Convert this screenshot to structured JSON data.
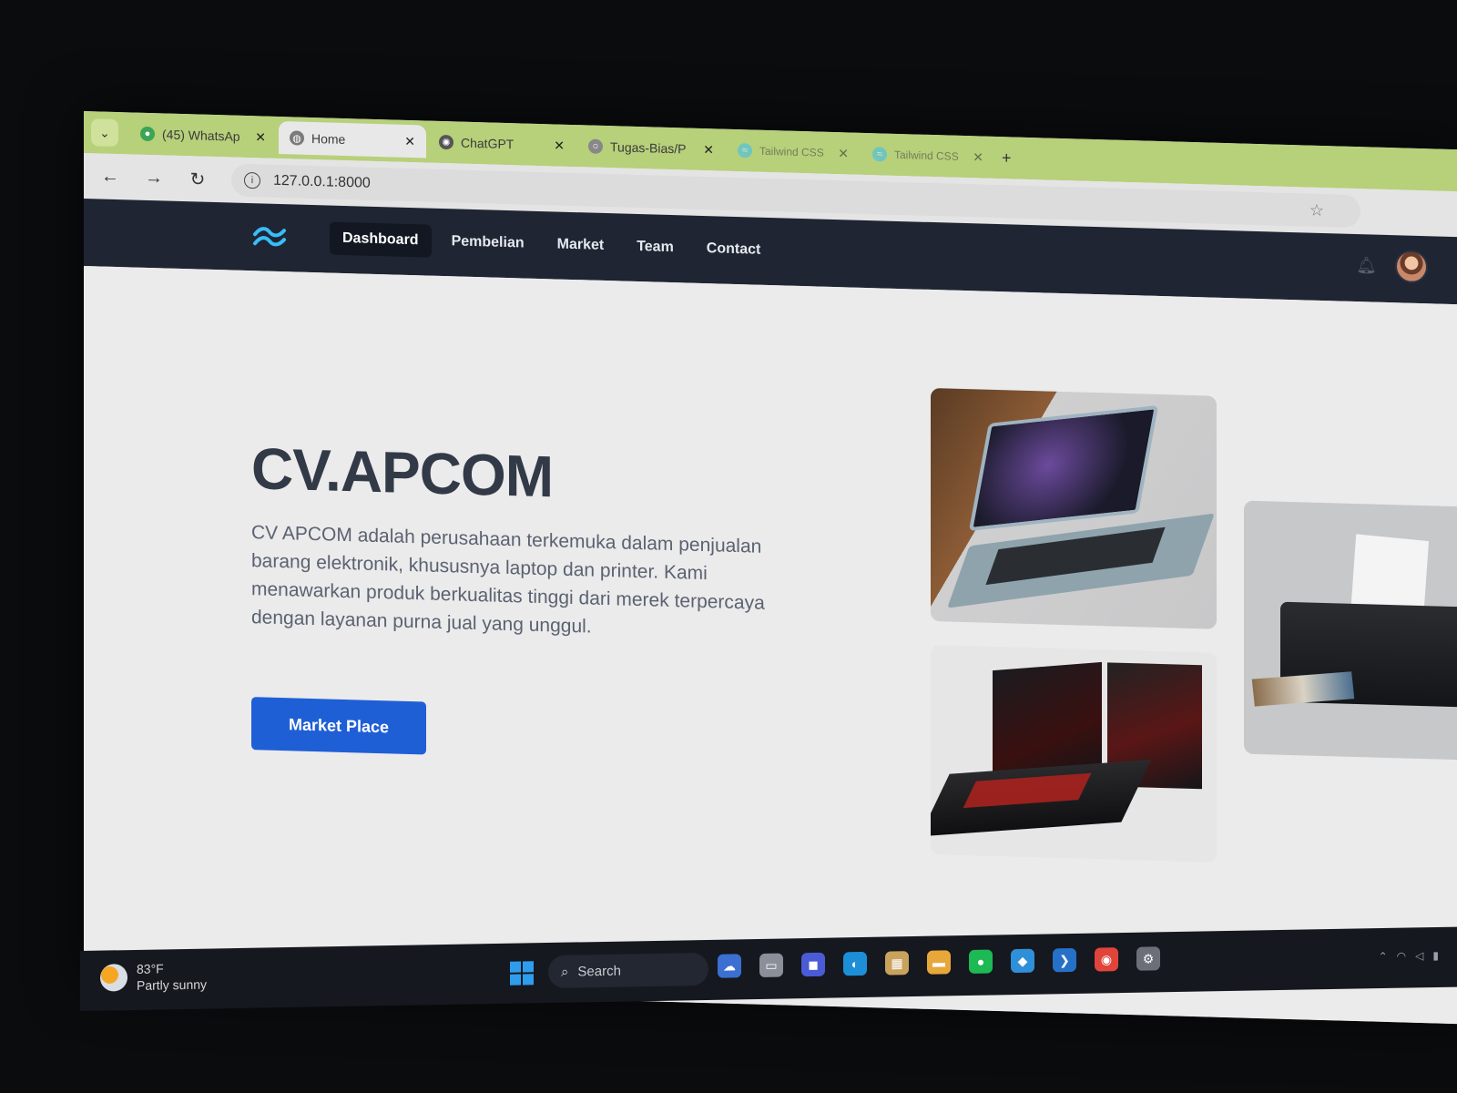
{
  "browser": {
    "tabs": [
      {
        "label": "(45) WhatsAp",
        "favicon": "whatsapp-icon",
        "active": false
      },
      {
        "label": "Home",
        "favicon": "globe-icon",
        "active": true
      },
      {
        "label": "ChatGPT",
        "favicon": "chatgpt-icon",
        "active": false
      },
      {
        "label": "Tugas-Bias/P",
        "favicon": "github-icon",
        "active": false
      },
      {
        "label": "Tailwind CSS",
        "favicon": "tailwind-icon",
        "active": false
      },
      {
        "label": "Tailwind CSS",
        "favicon": "tailwind-icon",
        "active": false
      }
    ],
    "url": "127.0.0.1:8000"
  },
  "site": {
    "nav": [
      "Dashboard",
      "Pembelian",
      "Market",
      "Team",
      "Contact"
    ],
    "hero": {
      "title": "CV.APCOM",
      "description": "CV APCOM adalah perusahaan terkemuka dalam penjualan barang elektronik, khususnya laptop dan printer. Kami menawarkan produk berkualitas tinggi dari merek terpercaya dengan layanan purna jual yang unggul.",
      "button": "Market Place"
    }
  },
  "taskbar": {
    "temperature": "83°F",
    "weather": "Partly sunny",
    "search": "Search"
  },
  "colors": {
    "navbar": "#1f2532",
    "button": "#1f5fd6",
    "tabstrip": "#b7d07a"
  }
}
